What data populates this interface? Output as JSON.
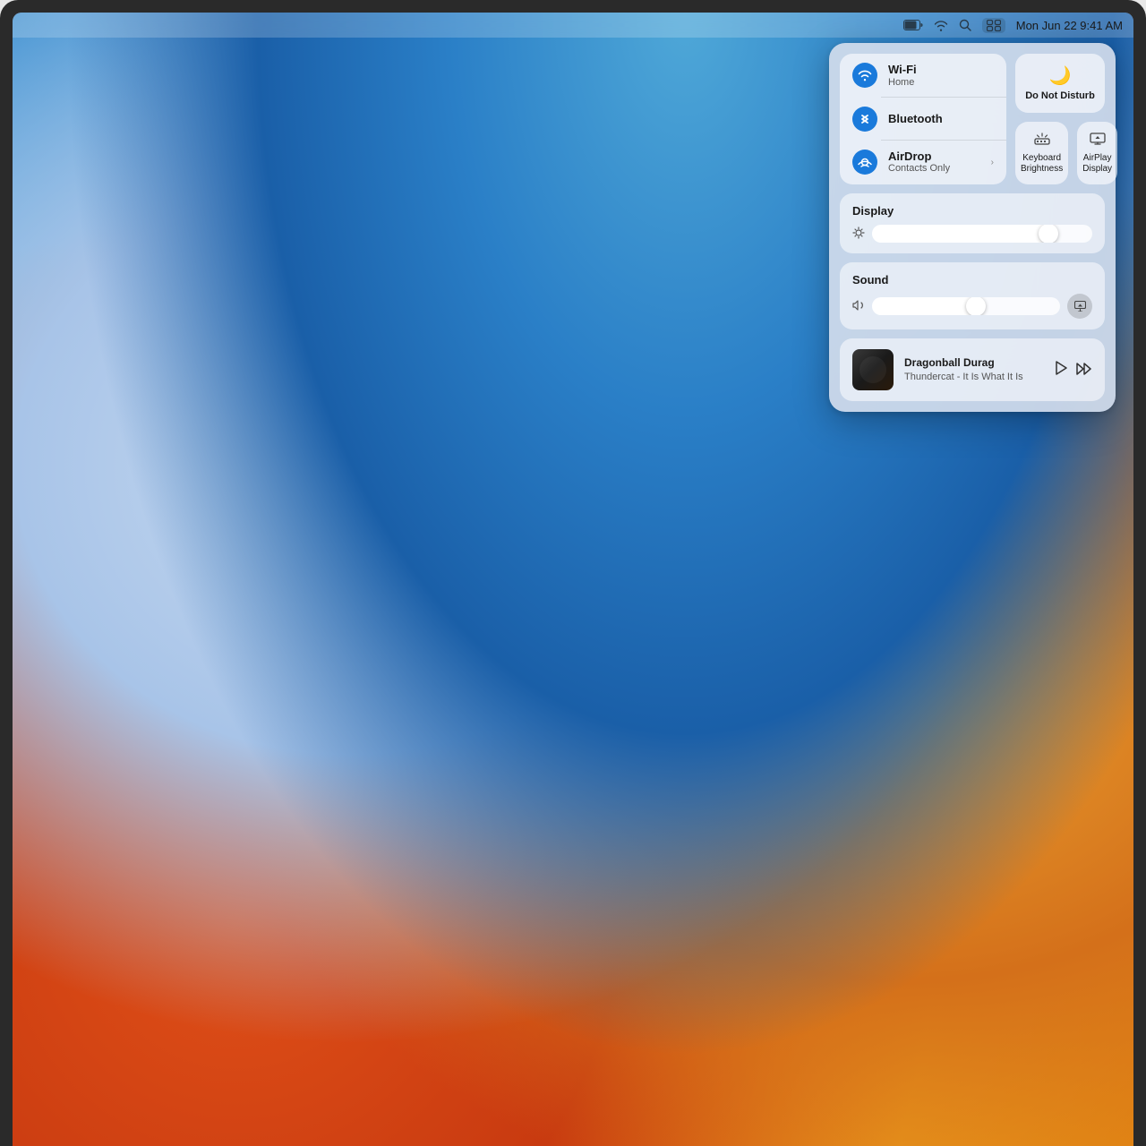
{
  "screen": {
    "bezel_color": "#2a2a2a"
  },
  "menubar": {
    "date_time": "Mon Jun 22  9:41 AM",
    "icons": [
      "battery",
      "wifi",
      "search",
      "control-center"
    ]
  },
  "control_center": {
    "connectivity": {
      "wifi": {
        "name": "Wi-Fi",
        "sub": "Home",
        "icon": "wifi",
        "active": true
      },
      "bluetooth": {
        "name": "Bluetooth",
        "sub": "",
        "icon": "bluetooth",
        "active": true
      },
      "airdrop": {
        "name": "AirDrop",
        "sub": "Contacts Only",
        "icon": "airdrop",
        "active": true,
        "has_chevron": true
      }
    },
    "dnd": {
      "label": "Do Not Disturb"
    },
    "keyboard_brightness": {
      "label": "Keyboard Brightness"
    },
    "airplay_display": {
      "label": "AirPlay Display"
    },
    "display": {
      "title": "Display",
      "brightness": 80
    },
    "sound": {
      "title": "Sound",
      "volume": 55
    },
    "now_playing": {
      "title": "Dragonball Durag",
      "artist": "Thundercat - It Is What It Is",
      "play_label": "▶",
      "skip_label": "⏭"
    }
  }
}
